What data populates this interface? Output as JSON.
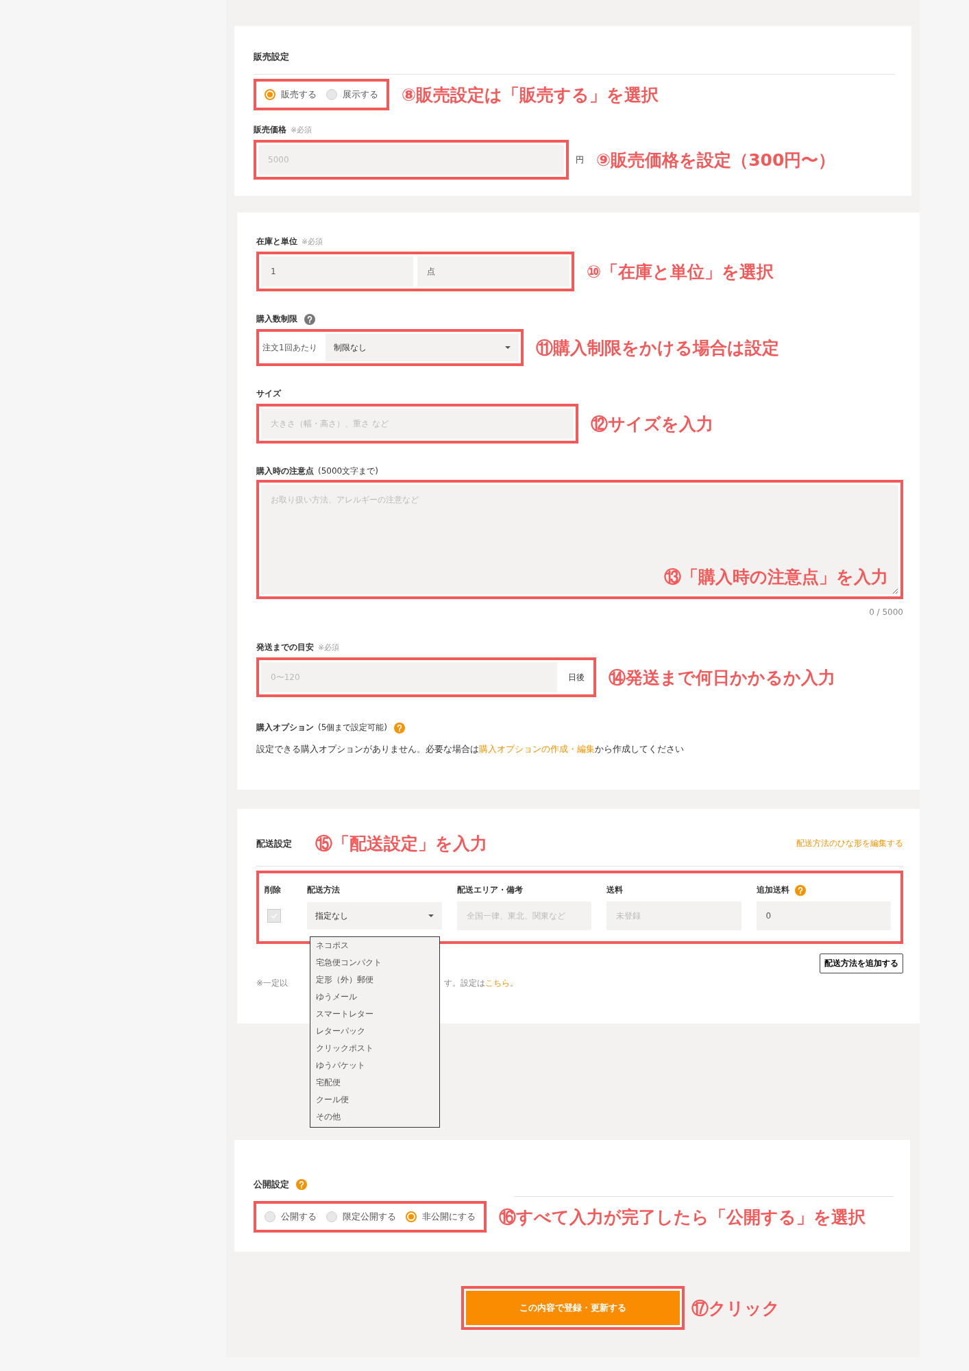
{
  "sales": {
    "title": "販売設定",
    "annotation": "⑧販売設定は「販売する」を選択",
    "options": [
      {
        "label": "販売する",
        "selected": true
      },
      {
        "label": "展示する",
        "selected": false
      }
    ],
    "price": {
      "label": "販売価格",
      "required": "※必須",
      "placeholder": "5000",
      "unit": "円",
      "annotation": "⑨販売価格を設定（300円〜）"
    }
  },
  "details": {
    "stock": {
      "label": "在庫と単位",
      "required": "※必須",
      "quantity": "1",
      "unit": "点",
      "annotation": "⑩「在庫と単位」を選択"
    },
    "purchase_limit": {
      "label": "購入数制限",
      "prefix": "注文1回あたり",
      "value": "制限なし",
      "annotation": "⑪購入制限をかける場合は設定"
    },
    "size": {
      "label": "サイズ",
      "placeholder": "大きさ（幅・高さ）、重さ など",
      "annotation": "⑫サイズを入力"
    },
    "notes": {
      "label": "購入時の注意点",
      "hint": "(5000文字まで)",
      "placeholder": "お取り扱い方法、アレルギーの注意など",
      "counter": "0 / 5000",
      "annotation": "⑬「購入時の注意点」を入力"
    },
    "shipping_time": {
      "label": "発送までの目安",
      "required": "※必須",
      "placeholder": "0〜120",
      "suffix": "日後",
      "annotation": "⑭発送まで何日かかるか入力"
    },
    "options": {
      "label": "購入オプション",
      "hint": "(5個まで設定可能)",
      "message_before": "設定できる購入オプションがありません。必要な場合は",
      "link": "購入オプションの作成・編集",
      "message_after": "から作成してください"
    }
  },
  "shipping": {
    "title": "配送設定",
    "annotation": "⑮「配送設定」を入力",
    "template_link": "配送方法のひな形を編集する",
    "columns": [
      "削除",
      "配送方法",
      "配送エリア・備考",
      "送料",
      "追加送料"
    ],
    "row": {
      "checked": true,
      "disabled": true,
      "method": "指定なし",
      "area_placeholder": "全国一律、東北、関東など",
      "fee_placeholder": "未登録",
      "extra_fee": "0"
    },
    "method_options": [
      "ネコポス",
      "宅急便コンパクト",
      "定形（外）郵便",
      "ゆうメール",
      "スマートレター",
      "レターパック",
      "クリックポスト",
      "ゆうパケット",
      "宅配便",
      "クール便",
      "その他"
    ],
    "add_button": "配送方法を追加する",
    "note_left": "※一定以",
    "note_right": "す。設定は",
    "note_link": "こちら",
    "note_end": "。"
  },
  "publish": {
    "title": "公開設定",
    "annotation": "⑯すべて入力が完了したら「公開する」を選択",
    "options": [
      {
        "label": "公開する",
        "selected": false
      },
      {
        "label": "限定公開する",
        "selected": false
      },
      {
        "label": "非公開にする",
        "selected": true
      }
    ]
  },
  "submit": {
    "label": "この内容で登録・更新する",
    "annotation": "⑰クリック"
  }
}
